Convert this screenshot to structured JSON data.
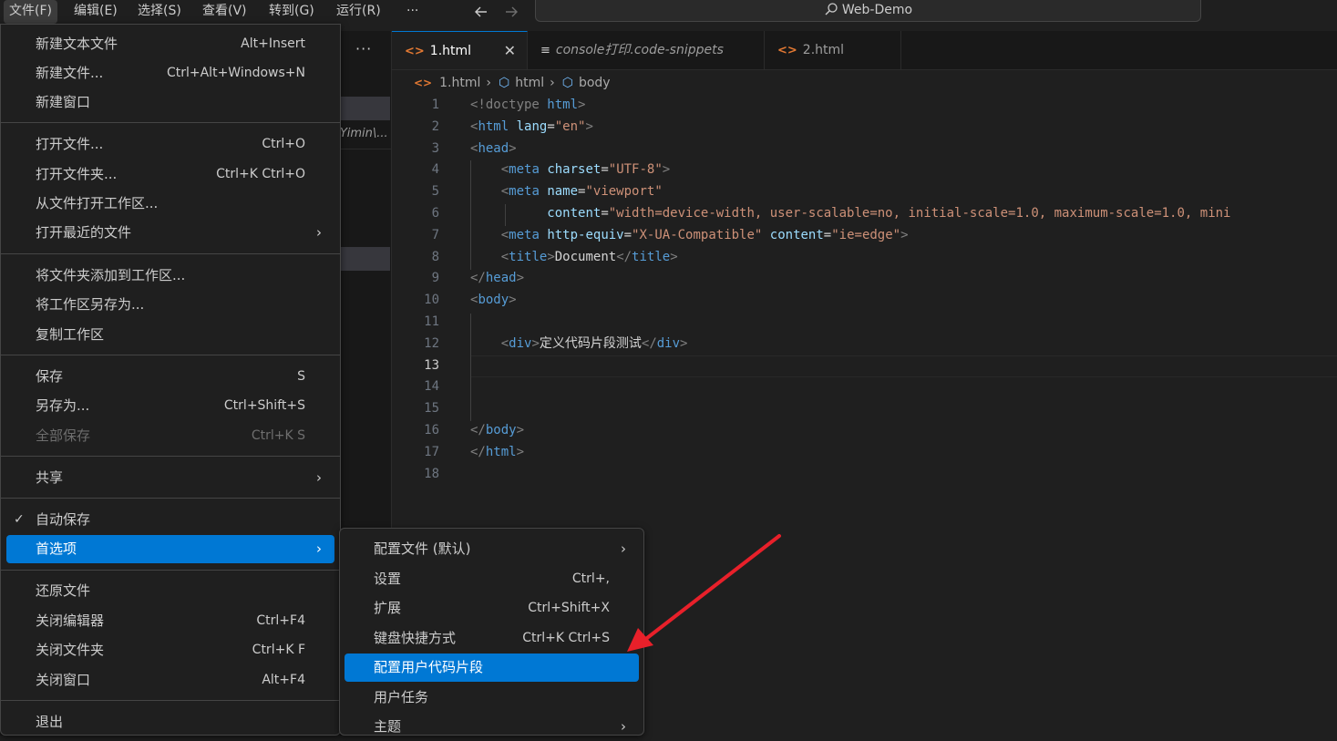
{
  "menubar": {
    "items": [
      "文件(F)",
      "编辑(E)",
      "选择(S)",
      "查看(V)",
      "转到(G)",
      "运行(R)"
    ],
    "more": "···",
    "back_icon": "arrow-left-icon",
    "forward_icon": "arrow-right-icon"
  },
  "command_center": {
    "label": "Web-Demo",
    "icon": "search-icon"
  },
  "sidebar": {
    "more": "···",
    "path_fragment": "Yimin\\..."
  },
  "tabs": [
    {
      "label": "1.html",
      "icon": "html-file-icon",
      "active": true,
      "close": "✕"
    },
    {
      "label": "console打印.code-snippets",
      "icon": "snippet-file-icon",
      "active": false
    },
    {
      "label": "2.html",
      "icon": "html-file-icon",
      "active": false
    }
  ],
  "breadcrumb": {
    "file": "1.html",
    "items": [
      "html",
      "body"
    ]
  },
  "editor": {
    "current_line": 13,
    "lines": [
      {
        "n": "1"
      },
      {
        "n": "2"
      },
      {
        "n": "3"
      },
      {
        "n": "4"
      },
      {
        "n": "5"
      },
      {
        "n": "6"
      },
      {
        "n": "7"
      },
      {
        "n": "8"
      },
      {
        "n": "9"
      },
      {
        "n": "10"
      },
      {
        "n": "11"
      },
      {
        "n": "12"
      },
      {
        "n": "13"
      },
      {
        "n": "14"
      },
      {
        "n": "15"
      },
      {
        "n": "16"
      },
      {
        "n": "17"
      },
      {
        "n": "18"
      }
    ],
    "tokens": {
      "doctype": "<!doctype",
      "html_kw": "html",
      "lang_attr": "lang",
      "lang_val": "\"en\"",
      "head": "head",
      "meta": "meta",
      "charset_attr": "charset",
      "charset_val": "\"UTF-8\"",
      "name_attr": "name",
      "name_val": "\"viewport\"",
      "content_attr": "content",
      "content_val": "\"width=device-width, user-scalable=no, initial-scale=1.0, maximum-scale=1.0, mini",
      "http_attr": "http-equiv",
      "http_val": "\"X-UA-Compatible\"",
      "content2_val": "\"ie=edge\"",
      "title": "title",
      "title_text": "Document",
      "body": "body",
      "div": "div",
      "div_text": "定义代码片段测试"
    }
  },
  "file_menu": {
    "groups": [
      [
        {
          "label": "新建文本文件",
          "shortcut": "Alt+Insert"
        },
        {
          "label": "新建文件...",
          "shortcut": "Ctrl+Alt+Windows+N"
        },
        {
          "label": "新建窗口",
          "shortcut": ""
        }
      ],
      [
        {
          "label": "打开文件...",
          "shortcut": "Ctrl+O"
        },
        {
          "label": "打开文件夹...",
          "shortcut": "Ctrl+K Ctrl+O"
        },
        {
          "label": "从文件打开工作区...",
          "shortcut": ""
        },
        {
          "label": "打开最近的文件",
          "shortcut": "",
          "submenu": true
        }
      ],
      [
        {
          "label": "将文件夹添加到工作区...",
          "shortcut": ""
        },
        {
          "label": "将工作区另存为...",
          "shortcut": ""
        },
        {
          "label": "复制工作区",
          "shortcut": ""
        }
      ],
      [
        {
          "label": "保存",
          "shortcut": "S"
        },
        {
          "label": "另存为...",
          "shortcut": "Ctrl+Shift+S"
        },
        {
          "label": "全部保存",
          "shortcut": "Ctrl+K S",
          "disabled": true
        }
      ],
      [
        {
          "label": "共享",
          "shortcut": "",
          "submenu": true
        }
      ],
      [
        {
          "label": "自动保存",
          "shortcut": "",
          "checked": true
        },
        {
          "label": "首选项",
          "shortcut": "",
          "submenu": true,
          "highlighted": true
        }
      ],
      [
        {
          "label": "还原文件",
          "shortcut": ""
        },
        {
          "label": "关闭编辑器",
          "shortcut": "Ctrl+F4"
        },
        {
          "label": "关闭文件夹",
          "shortcut": "Ctrl+K F"
        },
        {
          "label": "关闭窗口",
          "shortcut": "Alt+F4"
        }
      ],
      [
        {
          "label": "退出",
          "shortcut": ""
        }
      ]
    ],
    "submenu_arrow": "›",
    "check_mark": "✓"
  },
  "preferences_menu": {
    "items": [
      {
        "label": "配置文件 (默认)",
        "shortcut": "",
        "submenu": true
      },
      {
        "label": "设置",
        "shortcut": "Ctrl+,"
      },
      {
        "label": "扩展",
        "shortcut": "Ctrl+Shift+X"
      },
      {
        "label": "键盘快捷方式",
        "shortcut": "Ctrl+K Ctrl+S"
      },
      {
        "label": "配置用户代码片段",
        "shortcut": "",
        "highlighted": true
      },
      {
        "label": "用户任务",
        "shortcut": ""
      },
      {
        "label": "主题",
        "shortcut": "",
        "submenu": true
      }
    ]
  },
  "annotation": {
    "type": "arrow",
    "color": "#e8202a",
    "points_to": "配置用户代码片段"
  },
  "colors": {
    "accent": "#0078d4",
    "background": "#1f1f1f",
    "menu_border": "#454545"
  }
}
